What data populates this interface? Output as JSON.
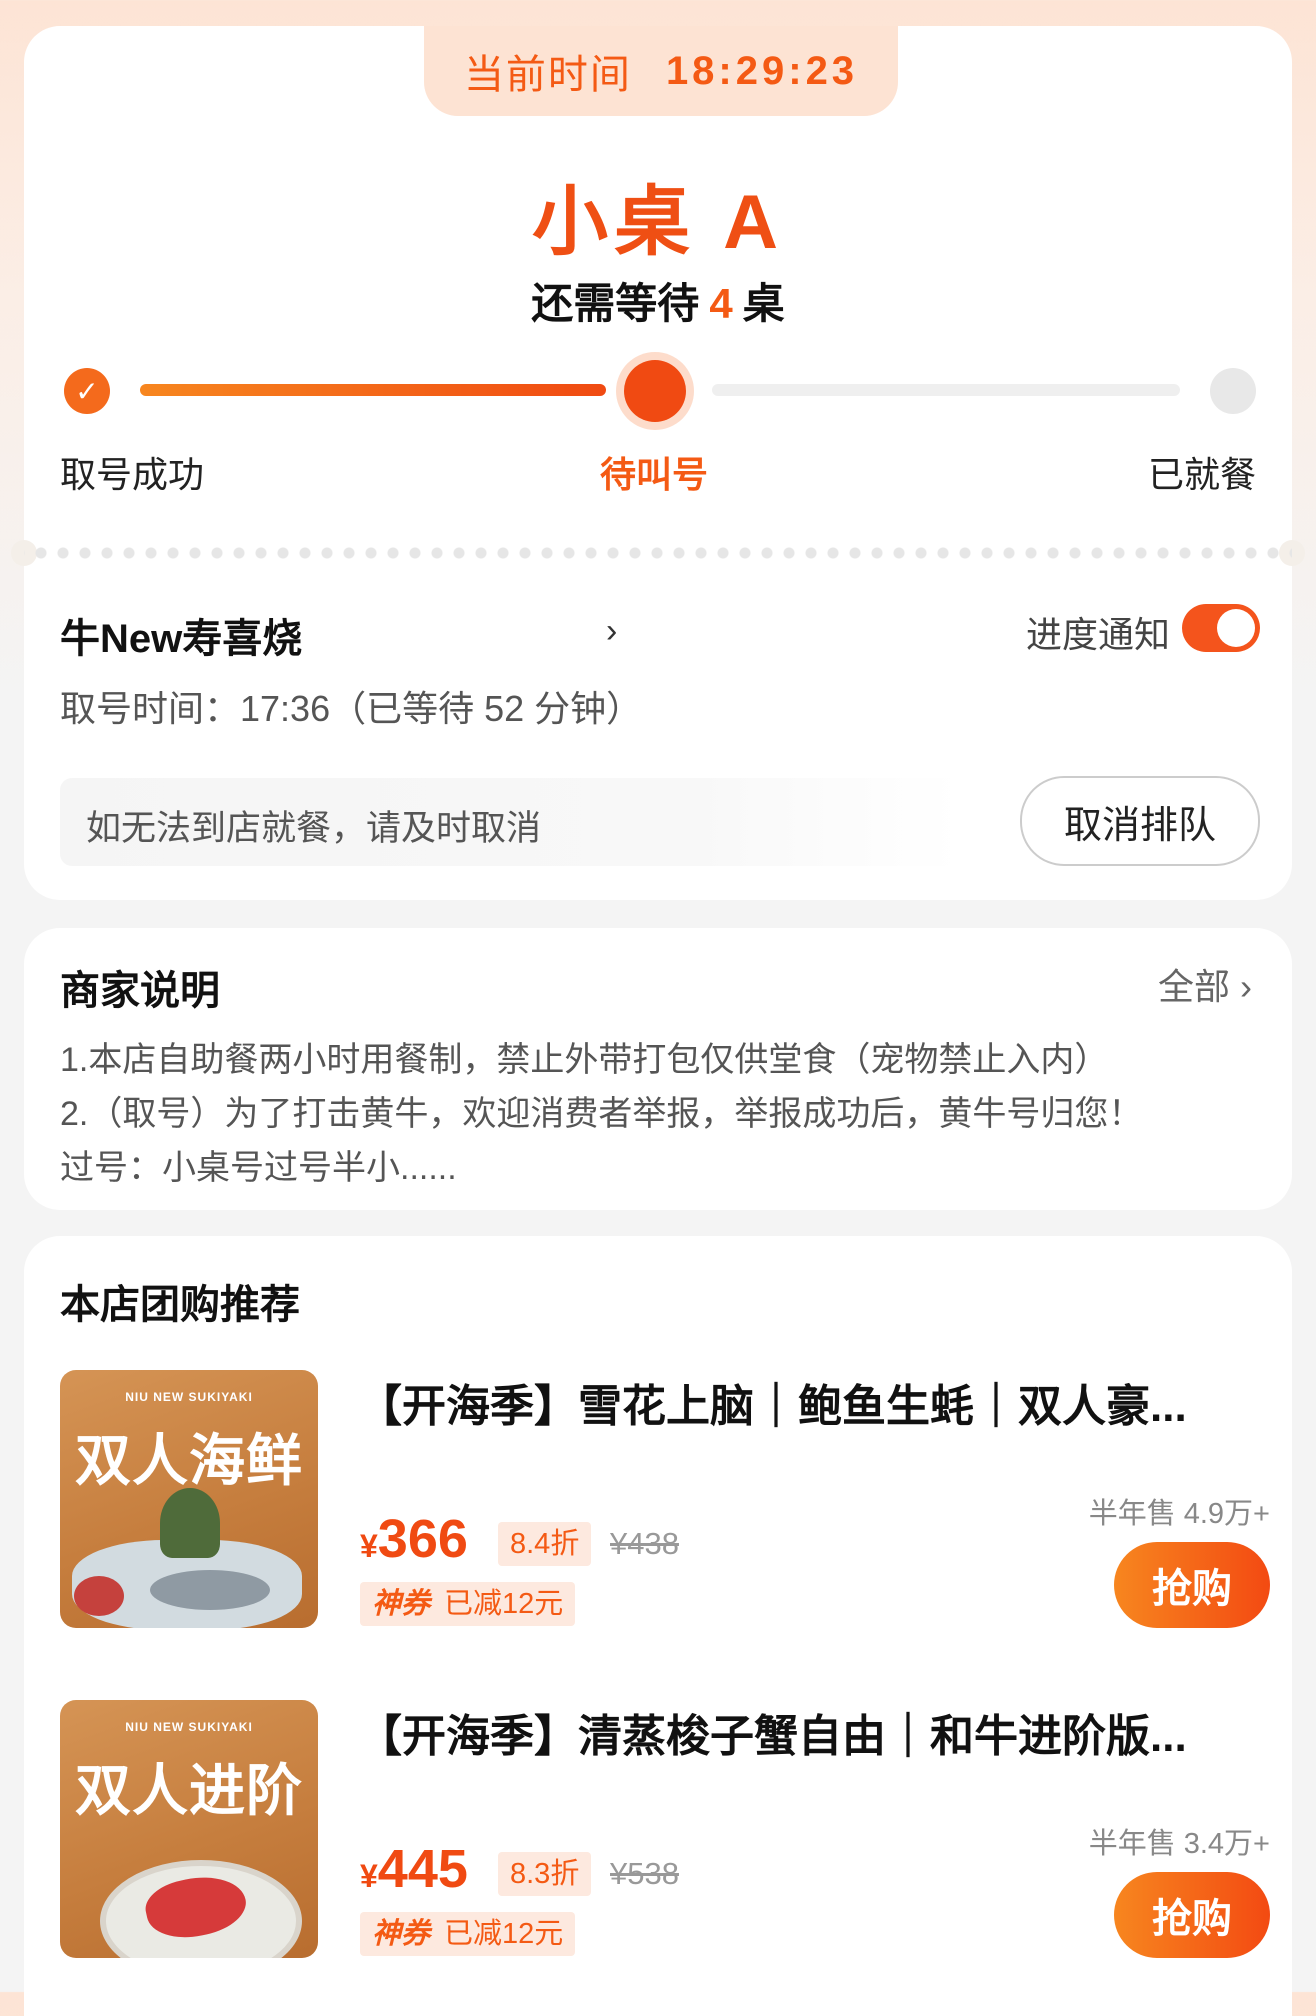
{
  "time_banner": {
    "label": "当前时间",
    "value": "18:29:23"
  },
  "queue": {
    "number": "小桌 A",
    "wait_prefix": "还需等待",
    "wait_count": "4",
    "wait_suffix": "桌",
    "steps": [
      {
        "label": "取号成功",
        "state": "done"
      },
      {
        "label": "待叫号",
        "state": "current"
      },
      {
        "label": "已就餐",
        "state": "pending"
      }
    ]
  },
  "shop": {
    "name": "牛New寿喜烧",
    "notify_label": "进度通知",
    "notify_on": true,
    "take_time": "取号时间：17:36（已等待 52 分钟）",
    "cancel_hint": "如无法到店就餐，请及时取消",
    "cancel_button": "取消排队"
  },
  "merchant_notice": {
    "title": "商家说明",
    "all_link": "全部",
    "lines": [
      "1.本店自助餐两小时用餐制，禁止外带打包仅供堂食（宠物禁止入内）",
      "2.（取号）为了打击黄牛，欢迎消费者举报，举报成功后，黄牛号归您！",
      "过号：小桌号过号半小......"
    ]
  },
  "deals": {
    "title": "本店团购推荐",
    "items": [
      {
        "thumb_brand": "NIU NEW SUKIYAKI",
        "thumb_text": "双人海鲜",
        "title": "【开海季】雪花上脑｜鲍鱼生蚝｜双人豪...",
        "sold": "半年售 4.9万+",
        "currency": "¥",
        "price": "366",
        "discount": "8.4折",
        "original": "¥438",
        "coupon_tag": "神券",
        "coupon_text": "已减12元",
        "buy_label": "抢购"
      },
      {
        "thumb_brand": "NIU NEW SUKIYAKI",
        "thumb_text": "双人进阶",
        "title": "【开海季】清蒸梭子蟹自由｜和牛进阶版...",
        "sold": "半年售 3.4万+",
        "currency": "¥",
        "price": "445",
        "discount": "8.3折",
        "original": "¥538",
        "coupon_tag": "神券",
        "coupon_text": "已减12元",
        "buy_label": "抢购"
      }
    ]
  },
  "colors": {
    "accent": "#f45a14",
    "accent_light": "#fde9df",
    "page_bg": "#f4f4f4"
  }
}
